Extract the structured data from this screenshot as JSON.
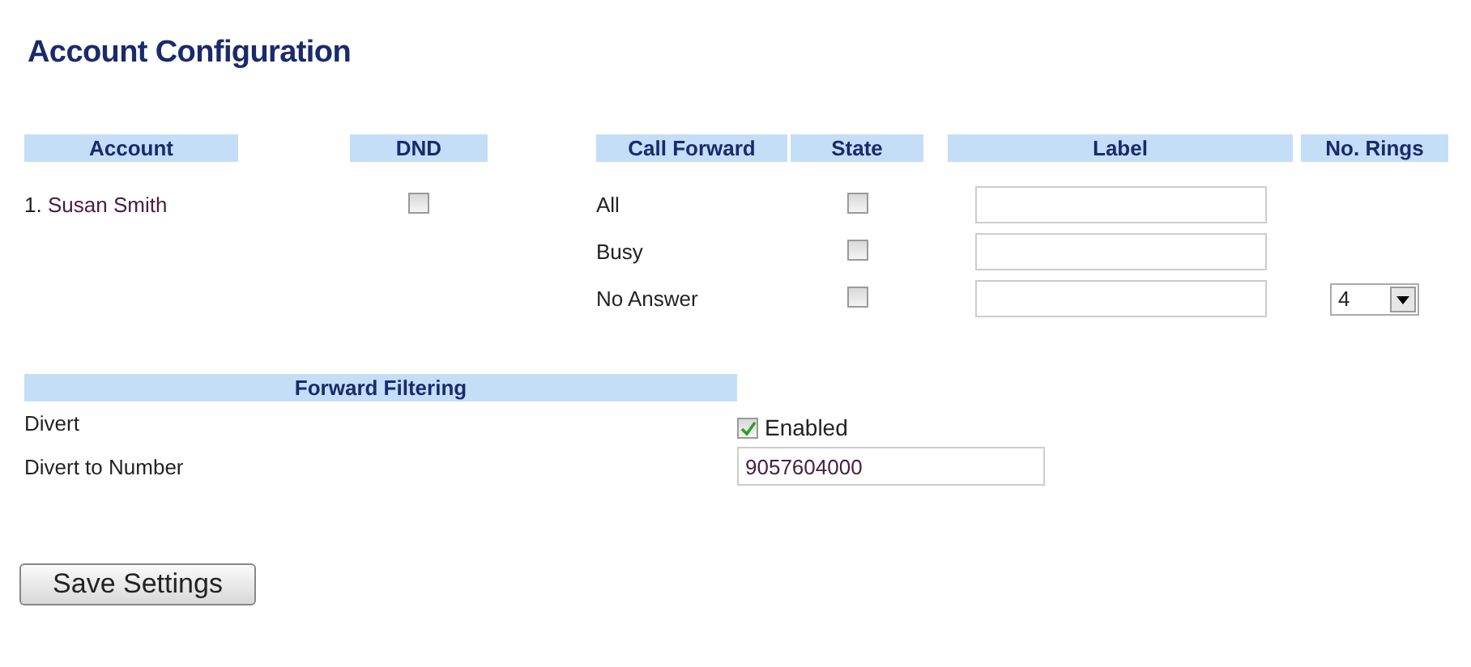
{
  "title": "Account Configuration",
  "columns": {
    "account": "Account",
    "dnd": "DND",
    "call_forward": "Call Forward",
    "state": "State",
    "label": "Label",
    "rings": "No. Rings"
  },
  "accounts": [
    {
      "number": "1.",
      "name": "Susan Smith",
      "dnd": false
    }
  ],
  "forwards": [
    {
      "name": "All",
      "checked": false
    },
    {
      "name": "Busy",
      "checked": false
    },
    {
      "name": "No Answer",
      "checked": false,
      "rings": "4"
    }
  ],
  "filtering": {
    "header": "Forward Filtering",
    "divert_label": "Divert",
    "divert_checked": true,
    "divert_text": "Enabled",
    "number_label": "Divert to Number",
    "number_value": "9057604000"
  },
  "save_button": "Save Settings"
}
